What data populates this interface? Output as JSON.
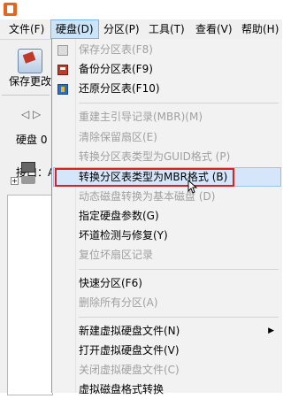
{
  "menubar": {
    "items": [
      "文件(F)",
      "硬盘(D)",
      "分区(P)",
      "工具(T)",
      "查看(V)",
      "帮助(H)"
    ],
    "active_index": 1
  },
  "leftpane": {
    "save_label": "保存更改",
    "disk_label": "硬盘 0",
    "interface_label": "接口：A"
  },
  "dropdown": {
    "items": [
      {
        "label": "保存分区表(F8)",
        "enabled": false,
        "icon": "save-table-icon"
      },
      {
        "label": "备份分区表(F9)",
        "enabled": true,
        "icon": "backup-table-icon"
      },
      {
        "label": "还原分区表(F10)",
        "enabled": true,
        "icon": "restore-table-icon"
      },
      {
        "label": "重建主引导记录(MBR)(M)",
        "enabled": false
      },
      {
        "label": "清除保留扇区(E)",
        "enabled": false
      },
      {
        "label": "转换分区表类型为GUID格式 (P)",
        "enabled": false
      },
      {
        "label": "转换分区表类型为MBR格式 (B)",
        "enabled": true,
        "highlighted": true
      },
      {
        "label": "动态磁盘转换为基本磁盘 (D)",
        "enabled": false
      },
      {
        "label": "指定硬盘参数(G)",
        "enabled": true
      },
      {
        "label": "坏道检测与修复(Y)",
        "enabled": true
      },
      {
        "label": "复位坏扇区记录",
        "enabled": false
      },
      {
        "label": "快速分区(F6)",
        "enabled": true
      },
      {
        "label": "删除所有分区(A)",
        "enabled": false
      },
      {
        "label": "新建虚拟硬盘文件(N)",
        "enabled": true,
        "submenu": true
      },
      {
        "label": "打开虚拟硬盘文件(V)",
        "enabled": true
      },
      {
        "label": "关闭虚拟硬盘文件(C)",
        "enabled": false
      },
      {
        "label": "虚拟磁盘格式转换",
        "enabled": true
      }
    ]
  },
  "colors": {
    "highlight_box": "#e0201c",
    "hover_fill": "#d5e6fa",
    "disabled_text": "#a0a0a0"
  }
}
